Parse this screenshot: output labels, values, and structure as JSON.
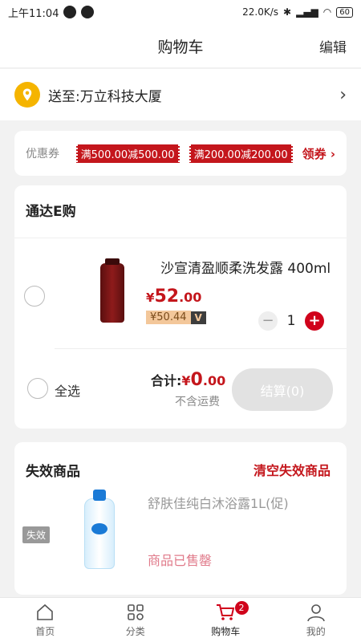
{
  "status_bar": {
    "time": "上午11:04",
    "net_speed": "22.0K/s",
    "battery": "60"
  },
  "header": {
    "title": "购物车",
    "edit_label": "编辑"
  },
  "address": {
    "prefix": "送至:",
    "text": "万立科技大厦"
  },
  "coupons": {
    "label": "优惠券",
    "items": [
      "满500.00减500.00",
      "满200.00减200.00"
    ],
    "get_label": "领券 ›"
  },
  "store": {
    "name": "通达E购",
    "product": {
      "name": "沙宣清盈顺柔洗发露 400ml",
      "price_currency": "¥",
      "price_int": "52",
      "price_dec": ".00",
      "vip_price": "¥50.44",
      "vip_tag": "V",
      "quantity": "1",
      "minus": "−",
      "plus": "+"
    },
    "select_all_label": "全选",
    "total_label": "合计:",
    "total_currency": "¥",
    "total_int": "0",
    "total_dec": ".00",
    "shipping_note": "不含运费",
    "checkout_label": "结算(0)"
  },
  "invalid": {
    "title": "失效商品",
    "clear_label": "清空失效商品",
    "badge": "失效",
    "product_name": "舒肤佳纯白沐浴露1L(促)",
    "status": "商品已售罄"
  },
  "tabbar": {
    "items": [
      {
        "label": "首页",
        "icon": "home-icon"
      },
      {
        "label": "分类",
        "icon": "category-icon"
      },
      {
        "label": "购物车",
        "icon": "cart-icon",
        "badge": "2",
        "active": true
      },
      {
        "label": "我的",
        "icon": "profile-icon"
      }
    ]
  },
  "colors": {
    "accent": "#c4161c",
    "pin": "#f5b400"
  }
}
